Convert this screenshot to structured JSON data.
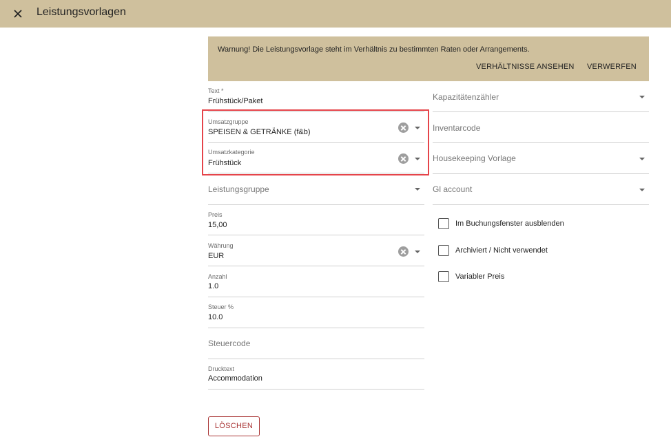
{
  "header": {
    "title": "Leistungsvorlagen"
  },
  "warning": {
    "text": "Warnung! Die Leistungsvorlage steht im Verhältnis zu bestimmten Raten oder Arrangements.",
    "view_label": "VERHÄLTNISSE ANSEHEN",
    "discard_label": "VERWERFEN"
  },
  "left_fields": {
    "text": {
      "label": "Text *",
      "value": "Frühstück/Paket"
    },
    "umsatzgruppe": {
      "label": "Umsatzgruppe",
      "value": "SPEISEN & GETRÄNKE (f&b)"
    },
    "umsatzkategorie": {
      "label": "Umsatzkategorie",
      "value": "Frühstück"
    },
    "leistungsgruppe": {
      "placeholder": "Leistungsgruppe"
    },
    "preis": {
      "label": "Preis",
      "value": "15,00"
    },
    "waehrung": {
      "label": "Währung",
      "value": "EUR"
    },
    "anzahl": {
      "label": "Anzahl",
      "value": "1.0"
    },
    "steuer": {
      "label": "Steuer %",
      "value": "10.0"
    },
    "steuercode": {
      "placeholder": "Steuercode"
    },
    "drucktext": {
      "label": "Drucktext",
      "value": "Accommodation"
    }
  },
  "right_fields": {
    "kapazitaet": {
      "placeholder": "Kapazitätenzähler"
    },
    "inventarcode": {
      "placeholder": "Inventarcode"
    },
    "housekeeping": {
      "placeholder": "Housekeeping Vorlage"
    },
    "gl_account": {
      "placeholder": "Gl account"
    }
  },
  "checkboxes": [
    {
      "label": "Im Buchungsfenster ausblenden",
      "checked": false
    },
    {
      "label": "Archiviert / Nicht verwendet",
      "checked": false
    },
    {
      "label": "Variabler Preis",
      "checked": false
    }
  ],
  "delete_label": "LÖSCHEN"
}
